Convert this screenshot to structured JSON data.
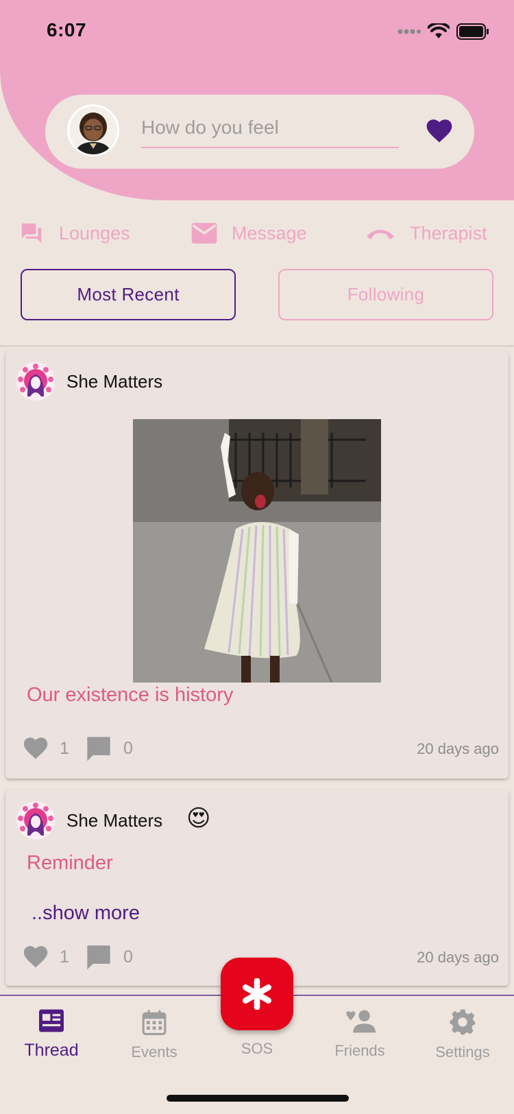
{
  "status_bar": {
    "time": "6:07"
  },
  "header": {
    "feel_placeholder": "How do you feel"
  },
  "shortcuts": [
    {
      "label": "Lounges",
      "icon": "chat-bubbles-icon"
    },
    {
      "label": "Message",
      "icon": "envelope-icon"
    },
    {
      "label": "Therapist",
      "icon": "phone-icon"
    }
  ],
  "tabs": {
    "most_recent": "Most Recent",
    "following": "Following"
  },
  "posts": [
    {
      "author": "She Matters",
      "text": "Our existence is history",
      "likes": "1",
      "comments": "0",
      "time": "20 days ago"
    },
    {
      "author": "She Matters",
      "text": "Reminder",
      "show_more": "..show more",
      "likes": "1",
      "comments": "0",
      "time": "20 days ago",
      "emoji": "😍"
    }
  ],
  "nav": {
    "thread": "Thread",
    "events": "Events",
    "sos": "SOS",
    "friends": "Friends",
    "settings": "Settings"
  },
  "colors": {
    "pink": "#efa6c6",
    "purple": "#4f1c83",
    "sos_red": "#e4051c",
    "post_text": "#de5a88",
    "background": "#efe5df"
  }
}
